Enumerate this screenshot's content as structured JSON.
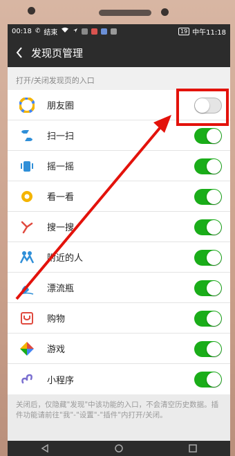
{
  "status_bar": {
    "time": "00:18",
    "call_label": "结束",
    "battery": "19",
    "clock": "中午11:18"
  },
  "nav": {
    "title": "发现页管理"
  },
  "section": {
    "header": "打开/关闭发现页的入口"
  },
  "items": [
    {
      "label": "朋友圈",
      "icon": "moments-icon",
      "enabled": false
    },
    {
      "label": "扫一扫",
      "icon": "scan-icon",
      "enabled": true
    },
    {
      "label": "摇一摇",
      "icon": "shake-icon",
      "enabled": true
    },
    {
      "label": "看一看",
      "icon": "top-stories-icon",
      "enabled": true
    },
    {
      "label": "搜一搜",
      "icon": "search-icon",
      "enabled": true
    },
    {
      "label": "附近的人",
      "icon": "people-nearby-icon",
      "enabled": true
    },
    {
      "label": "漂流瓶",
      "icon": "drift-bottle-icon",
      "enabled": true
    },
    {
      "label": "购物",
      "icon": "shopping-icon",
      "enabled": true
    },
    {
      "label": "游戏",
      "icon": "games-icon",
      "enabled": true
    },
    {
      "label": "小程序",
      "icon": "mini-programs-icon",
      "enabled": true
    }
  ],
  "footnote": "关闭后，仅隐藏\"发现\"中该功能的入口，不会清空历史数据。插件功能请前往\"我\"-\"设置\"-\"插件\"内打开/关闭。",
  "colors": {
    "toggle_on": "#1aad19",
    "annotation_red": "#e3120b",
    "header_bg": "#2c2c2c"
  }
}
